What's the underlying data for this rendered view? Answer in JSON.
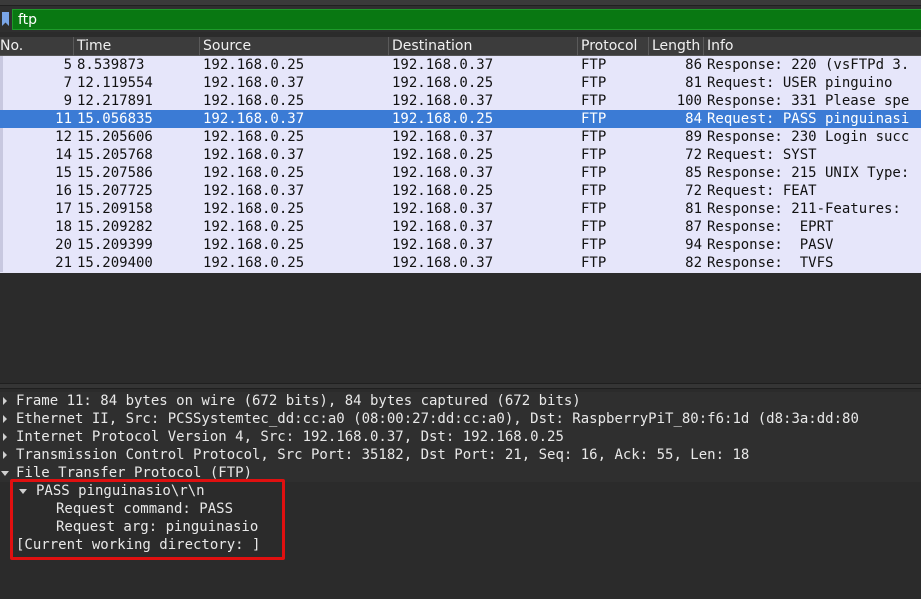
{
  "filter": {
    "value": "ftp"
  },
  "packet_list": {
    "columns": [
      "No.",
      "Time",
      "Source",
      "Destination",
      "Protocol",
      "Length",
      "Info"
    ],
    "rows": [
      {
        "no": "5",
        "time": "8.539873",
        "src": "192.168.0.25",
        "dst": "192.168.0.37",
        "proto": "FTP",
        "len": "86",
        "info": "Response: 220 (vsFTPd 3.",
        "selected": false
      },
      {
        "no": "7",
        "time": "12.119554",
        "src": "192.168.0.37",
        "dst": "192.168.0.25",
        "proto": "FTP",
        "len": "81",
        "info": "Request: USER pinguino",
        "selected": false
      },
      {
        "no": "9",
        "time": "12.217891",
        "src": "192.168.0.25",
        "dst": "192.168.0.37",
        "proto": "FTP",
        "len": "100",
        "info": "Response: 331 Please spe",
        "selected": false
      },
      {
        "no": "11",
        "time": "15.056835",
        "src": "192.168.0.37",
        "dst": "192.168.0.25",
        "proto": "FTP",
        "len": "84",
        "info": "Request: PASS pinguinasi",
        "selected": true
      },
      {
        "no": "12",
        "time": "15.205606",
        "src": "192.168.0.25",
        "dst": "192.168.0.37",
        "proto": "FTP",
        "len": "89",
        "info": "Response: 230 Login succ",
        "selected": false
      },
      {
        "no": "14",
        "time": "15.205768",
        "src": "192.168.0.37",
        "dst": "192.168.0.25",
        "proto": "FTP",
        "len": "72",
        "info": "Request: SYST",
        "selected": false
      },
      {
        "no": "15",
        "time": "15.207586",
        "src": "192.168.0.25",
        "dst": "192.168.0.37",
        "proto": "FTP",
        "len": "85",
        "info": "Response: 215 UNIX Type:",
        "selected": false
      },
      {
        "no": "16",
        "time": "15.207725",
        "src": "192.168.0.37",
        "dst": "192.168.0.25",
        "proto": "FTP",
        "len": "72",
        "info": "Request: FEAT",
        "selected": false
      },
      {
        "no": "17",
        "time": "15.209158",
        "src": "192.168.0.25",
        "dst": "192.168.0.37",
        "proto": "FTP",
        "len": "81",
        "info": "Response: 211-Features:",
        "selected": false
      },
      {
        "no": "18",
        "time": "15.209282",
        "src": "192.168.0.25",
        "dst": "192.168.0.37",
        "proto": "FTP",
        "len": "87",
        "info": "Response:  EPRT",
        "selected": false
      },
      {
        "no": "20",
        "time": "15.209399",
        "src": "192.168.0.25",
        "dst": "192.168.0.37",
        "proto": "FTP",
        "len": "94",
        "info": "Response:  PASV",
        "selected": false
      },
      {
        "no": "21",
        "time": "15.209400",
        "src": "192.168.0.25",
        "dst": "192.168.0.37",
        "proto": "FTP",
        "len": "82",
        "info": "Response:  TVFS",
        "selected": false
      }
    ]
  },
  "details": {
    "frame": "Frame 11: 84 bytes on wire (672 bits), 84 bytes captured (672 bits)",
    "ethernet": "Ethernet II, Src: PCSSystemtec_dd:cc:a0 (08:00:27:dd:cc:a0), Dst: RaspberryPiT_80:f6:1d (d8:3a:dd:80",
    "ip": "Internet Protocol Version 4, Src: 192.168.0.37, Dst: 192.168.0.25",
    "tcp": "Transmission Control Protocol, Src Port: 35182, Dst Port: 21, Seq: 16, Ack: 55, Len: 18",
    "ftp": "File Transfer Protocol (FTP)",
    "pass_line": "PASS pinguinasio\\r\\n",
    "request_command": "Request command: PASS",
    "request_arg": "Request arg: pinguinasio",
    "cwd": "[Current working directory: ]"
  },
  "colors": {
    "filter_bg": "#097812",
    "selected_row": "#3b7bd5",
    "row_bg": "#e6e6fa",
    "highlight_border": "#e01010"
  },
  "icons": {
    "bookmark": "bookmark-icon",
    "expand": "triangle-right-icon",
    "collapse": "triangle-down-icon"
  }
}
